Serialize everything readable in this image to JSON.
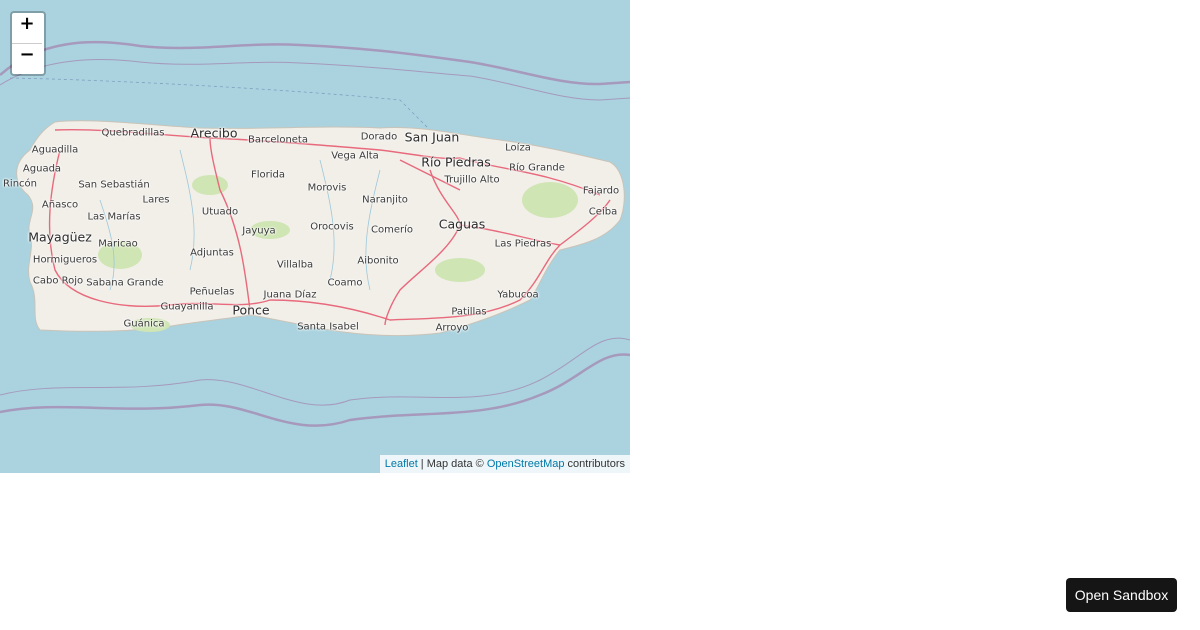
{
  "map": {
    "zoom_in_label": "+",
    "zoom_out_label": "−",
    "colors": {
      "water": "#aad3df",
      "land": "#f2efe9",
      "road": "#e8697c",
      "boundary": "#a58bb3"
    },
    "places": [
      {
        "name": "Quebradillas",
        "size": "small"
      },
      {
        "name": "Arecibo",
        "size": "big"
      },
      {
        "name": "Barceloneta",
        "size": "small"
      },
      {
        "name": "Dorado",
        "size": "small"
      },
      {
        "name": "San Juan",
        "size": "big"
      },
      {
        "name": "Aguadilla",
        "size": "small"
      },
      {
        "name": "Vega Alta",
        "size": "small"
      },
      {
        "name": "Río Piedras",
        "size": "big"
      },
      {
        "name": "Loíza",
        "size": "small"
      },
      {
        "name": "Aguada",
        "size": "small"
      },
      {
        "name": "Florida",
        "size": "small"
      },
      {
        "name": "Trujillo Alto",
        "size": "small"
      },
      {
        "name": "Río Grande",
        "size": "small"
      },
      {
        "name": "Rincón",
        "size": "small"
      },
      {
        "name": "San Sebastián",
        "size": "small"
      },
      {
        "name": "Morovis",
        "size": "small"
      },
      {
        "name": "Fajardo",
        "size": "small"
      },
      {
        "name": "Lares",
        "size": "small"
      },
      {
        "name": "Naranjito",
        "size": "small"
      },
      {
        "name": "Añasco",
        "size": "small"
      },
      {
        "name": "Utuado",
        "size": "small"
      },
      {
        "name": "Ceiba",
        "size": "small"
      },
      {
        "name": "Las Marías",
        "size": "small"
      },
      {
        "name": "Caguas",
        "size": "big"
      },
      {
        "name": "Orocovis",
        "size": "small"
      },
      {
        "name": "Comerío",
        "size": "small"
      },
      {
        "name": "Jayuya",
        "size": "small"
      },
      {
        "name": "Mayagüez",
        "size": "big"
      },
      {
        "name": "Maricao",
        "size": "small"
      },
      {
        "name": "Las Piedras",
        "size": "small"
      },
      {
        "name": "Adjuntas",
        "size": "small"
      },
      {
        "name": "Hormigueros",
        "size": "small"
      },
      {
        "name": "Aibonito",
        "size": "small"
      },
      {
        "name": "Villalba",
        "size": "small"
      },
      {
        "name": "Cabo Rojo",
        "size": "small"
      },
      {
        "name": "Sabana Grande",
        "size": "small"
      },
      {
        "name": "Coamo",
        "size": "small"
      },
      {
        "name": "Peñuelas",
        "size": "small"
      },
      {
        "name": "Juana Díaz",
        "size": "small"
      },
      {
        "name": "Yabucoa",
        "size": "small"
      },
      {
        "name": "Guayanilla",
        "size": "small"
      },
      {
        "name": "Ponce",
        "size": "big"
      },
      {
        "name": "Patillas",
        "size": "small"
      },
      {
        "name": "Guánica",
        "size": "small"
      },
      {
        "name": "Santa Isabel",
        "size": "small"
      },
      {
        "name": "Arroyo",
        "size": "small"
      }
    ],
    "attribution": {
      "leaflet": "Leaflet",
      "separator": " | Map data © ",
      "osm": "OpenStreetMap",
      "suffix": " contributors"
    }
  },
  "sandbox_button_label": "Open Sandbox"
}
